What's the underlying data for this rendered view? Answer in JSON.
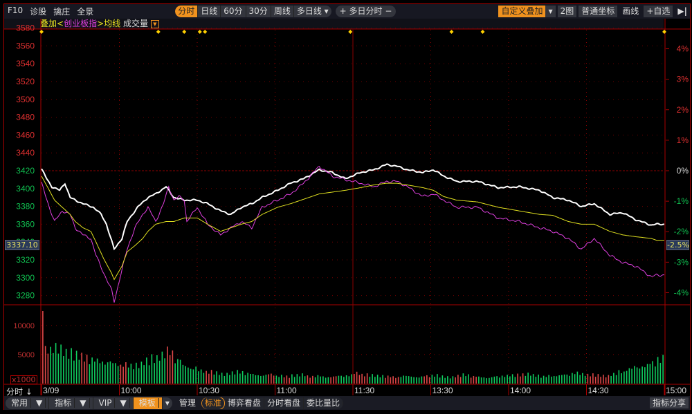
{
  "toolbar": {
    "left": [
      "F10",
      "诊股",
      "擒庄",
      "全景"
    ],
    "periods": [
      {
        "label": "分时",
        "active": true
      },
      {
        "label": "日线"
      },
      {
        "label": "60分"
      },
      {
        "label": "30分"
      },
      {
        "label": "周线"
      },
      {
        "label": "多日线 ▾"
      }
    ],
    "multi_day": "+ 多日分时 −",
    "custom_overlay": "自定义叠加",
    "two_chart": "2图",
    "coord": "普通坐标",
    "draw": "画线",
    "add_watch": "+自选",
    "collapse": "▶|"
  },
  "legend": {
    "overlay": "叠加<",
    "index": "创业板指",
    "avg": ">均线",
    "volume": "成交量"
  },
  "colors": {
    "index_line": "#ffffff",
    "overlay_line": "#e040e0",
    "avg_line": "#e0e020",
    "up": "#ff4040",
    "down": "#00d060",
    "grid": "#8b0000",
    "marker": "#ffd000"
  },
  "price_label": "3337.10",
  "pct_label": "-2.5%",
  "volume_unit": "x1000",
  "time_mode": "分时",
  "chart_data": {
    "type": "line",
    "base_price": 3420,
    "ylim": [
      3270,
      3590
    ],
    "yticks": [
      3580,
      3560,
      3540,
      3520,
      3500,
      3480,
      3460,
      3440,
      3420,
      3400,
      3380,
      3360,
      3340,
      3320,
      3300,
      3280
    ],
    "pct_ticks": [
      "4%",
      "3%",
      "2%",
      "1%",
      "0%",
      "-1%",
      "-2%",
      "-3%",
      "-4%"
    ],
    "pct_values": [
      4,
      3,
      2,
      1,
      0,
      -1,
      -2,
      -3,
      -4
    ],
    "xlabels": [
      {
        "t": 0,
        "label": "3/09"
      },
      {
        "t": 30,
        "label": "10:00"
      },
      {
        "t": 60,
        "label": "10:30"
      },
      {
        "t": 90,
        "label": "11:00"
      },
      {
        "t": 120,
        "label": "11:30"
      },
      {
        "t": 150,
        "label": "13:30"
      },
      {
        "t": 180,
        "label": "14:00"
      },
      {
        "t": 210,
        "label": "14:30"
      },
      {
        "t": 240,
        "label": "15:00"
      }
    ],
    "x_unit": "trading minutes",
    "markers": [
      0,
      45,
      55,
      61,
      63,
      119,
      158,
      170,
      240
    ],
    "series": [
      {
        "name": "index",
        "t": [
          0,
          2,
          4,
          7,
          9,
          11,
          13,
          16,
          20,
          23,
          25,
          28,
          31,
          33,
          37,
          41,
          44,
          48,
          51,
          55,
          60,
          64,
          69,
          73,
          77,
          81,
          85,
          91,
          96,
          101,
          107,
          112,
          117,
          123,
          128,
          133,
          137,
          141,
          147,
          151,
          155,
          160,
          168,
          176,
          184,
          192,
          197,
          203,
          208,
          213,
          219,
          224,
          229,
          235,
          237,
          240
        ],
        "values": [
          3422,
          3411,
          3402,
          3398,
          3406,
          3390,
          3387,
          3383,
          3379,
          3371,
          3360,
          3332,
          3344,
          3363,
          3379,
          3390,
          3394,
          3402,
          3390,
          3387,
          3387,
          3383,
          3375,
          3371,
          3379,
          3383,
          3390,
          3398,
          3406,
          3411,
          3421,
          3418,
          3411,
          3418,
          3421,
          3427,
          3425,
          3421,
          3418,
          3421,
          3414,
          3408,
          3408,
          3401,
          3402,
          3398,
          3390,
          3387,
          3380,
          3383,
          3371,
          3373,
          3365,
          3359,
          3360,
          3360
        ]
      },
      {
        "name": "创业板指",
        "t": [
          0,
          3,
          5,
          8,
          11,
          13,
          16,
          19,
          21,
          24,
          27,
          28,
          31,
          33,
          36,
          39,
          41,
          44,
          47,
          49,
          51,
          53,
          55,
          56,
          60,
          64,
          69,
          73,
          77,
          81,
          85,
          91,
          96,
          101,
          107,
          112,
          117,
          123,
          128,
          133,
          137,
          141,
          147,
          151,
          155,
          160,
          168,
          176,
          184,
          192,
          197,
          203,
          208,
          213,
          219,
          224,
          229,
          235,
          237,
          240
        ],
        "values": [
          3406,
          3379,
          3363,
          3375,
          3371,
          3356,
          3348,
          3344,
          3325,
          3305,
          3286,
          3273,
          3309,
          3332,
          3356,
          3371,
          3379,
          3363,
          3383,
          3402,
          3387,
          3391,
          3387,
          3363,
          3379,
          3360,
          3348,
          3356,
          3363,
          3356,
          3379,
          3387,
          3394,
          3406,
          3425,
          3414,
          3410,
          3406,
          3402,
          3408,
          3408,
          3402,
          3391,
          3394,
          3387,
          3379,
          3379,
          3367,
          3363,
          3356,
          3352,
          3344,
          3332,
          3344,
          3325,
          3317,
          3313,
          3301,
          3303,
          3303
        ]
      },
      {
        "name": "均线",
        "t": [
          0,
          3,
          5,
          8,
          11,
          13,
          16,
          19,
          21,
          24,
          27,
          28,
          31,
          33,
          36,
          39,
          41,
          44,
          48,
          51,
          55,
          60,
          64,
          69,
          73,
          77,
          81,
          85,
          91,
          96,
          101,
          107,
          112,
          117,
          123,
          128,
          133,
          137,
          141,
          147,
          151,
          155,
          160,
          168,
          176,
          184,
          192,
          197,
          203,
          208,
          213,
          219,
          224,
          229,
          235,
          237,
          240
        ],
        "values": [
          3414,
          3398,
          3387,
          3379,
          3371,
          3363,
          3356,
          3352,
          3340,
          3321,
          3305,
          3298,
          3313,
          3329,
          3336,
          3344,
          3352,
          3360,
          3363,
          3363,
          3367,
          3367,
          3360,
          3352,
          3356,
          3360,
          3363,
          3371,
          3379,
          3383,
          3388,
          3394,
          3396,
          3398,
          3401,
          3404,
          3406,
          3406,
          3404,
          3401,
          3398,
          3391,
          3387,
          3385,
          3379,
          3375,
          3371,
          3370,
          3363,
          3360,
          3360,
          3352,
          3348,
          3346,
          3344,
          3342,
          3342
        ]
      }
    ],
    "volume": {
      "yticks": [
        10000,
        5000
      ],
      "step_minutes": 3,
      "values": [
        12500,
        6000,
        5800,
        5200,
        4800,
        4500,
        4000,
        3800,
        3600,
        3400,
        3200,
        3000,
        3200,
        3800,
        4300,
        4800,
        5500,
        4000,
        3000,
        2600,
        2200,
        2000,
        1800,
        1600,
        1800,
        2000,
        1700,
        1500,
        1400,
        1600,
        1300,
        1200,
        1400,
        1500,
        1200,
        1300,
        1100,
        1200,
        1300,
        1400,
        1800,
        1500,
        1400,
        1300,
        1200,
        1100,
        1300,
        1200,
        1100,
        1300,
        1400,
        1200,
        1100,
        1300,
        1500,
        1200,
        1100,
        1000,
        1200,
        1300,
        1400,
        1500,
        1600,
        1400,
        1200,
        1300,
        1400,
        1500,
        1800,
        1600,
        1500,
        1400,
        1300,
        1600,
        2000,
        2500,
        2800,
        3000,
        3500,
        4200
      ],
      "dir": "rggggrggggrgggggrggggrgggggggrgrggrggrggrrggrrgggrgggrgrgggggrggggggggrrrgggggggg"
    }
  },
  "bottom": {
    "tabs": [
      "常用",
      "指标",
      "VIP",
      "模板"
    ],
    "manage": "管理",
    "views": [
      "标准",
      "博弈看盘",
      "分时看盘",
      "委比量比"
    ],
    "share": "指标分享"
  }
}
